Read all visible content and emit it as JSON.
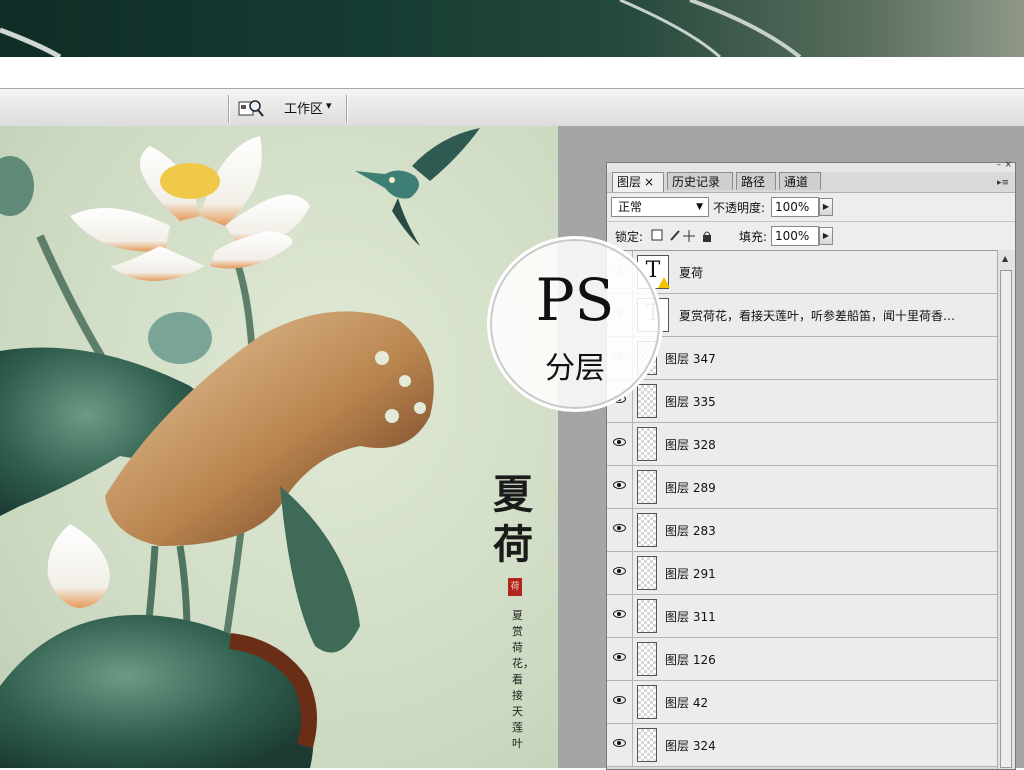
{
  "toolbar": {
    "workspace_label": "工作区",
    "workspace_arrow": "▾",
    "workspace_icon": "workspace-icon"
  },
  "badge": {
    "title": "PS",
    "subtitle": "分层"
  },
  "artwork": {
    "title": "夏荷",
    "seal_char": "荷",
    "poem": "夏赏荷花，看接天莲叶"
  },
  "layers_panel": {
    "tabs": [
      {
        "label": "图层",
        "close": "×"
      },
      {
        "label": "历史记录"
      },
      {
        "label": "路径"
      },
      {
        "label": "通道"
      }
    ],
    "blend_mode": "正常",
    "opacity_label": "不透明度:",
    "opacity_value": "100%",
    "lock_label": "锁定:",
    "fill_label": "填充:",
    "fill_value": "100%",
    "layers": [
      {
        "type": "text",
        "name": "夏荷",
        "warning": true,
        "visible": false
      },
      {
        "type": "text",
        "name": "夏赏荷花，看接天莲叶，听参差船笛，闻十里荷香…",
        "visible": false
      },
      {
        "type": "pixel",
        "name": "图层 347",
        "visible": false
      },
      {
        "type": "pixel",
        "name": "图层 335",
        "visible": true
      },
      {
        "type": "pixel",
        "name": "图层 328",
        "visible": true
      },
      {
        "type": "pixel",
        "name": "图层 289",
        "visible": true
      },
      {
        "type": "pixel",
        "name": "图层 283",
        "visible": true
      },
      {
        "type": "pixel",
        "name": "图层 291",
        "visible": true
      },
      {
        "type": "pixel",
        "name": "图层 311",
        "visible": true
      },
      {
        "type": "pixel",
        "name": "图层 126",
        "visible": true
      },
      {
        "type": "pixel",
        "name": "图层 42",
        "visible": true
      },
      {
        "type": "pixel",
        "name": "图层 324",
        "visible": true
      }
    ]
  },
  "colors": {
    "canvas_bg": "#ccd9c1",
    "panel_bg": "#d9d9d9",
    "workspace_bg": "#a5a5a5",
    "seal_red": "#b0261c"
  }
}
